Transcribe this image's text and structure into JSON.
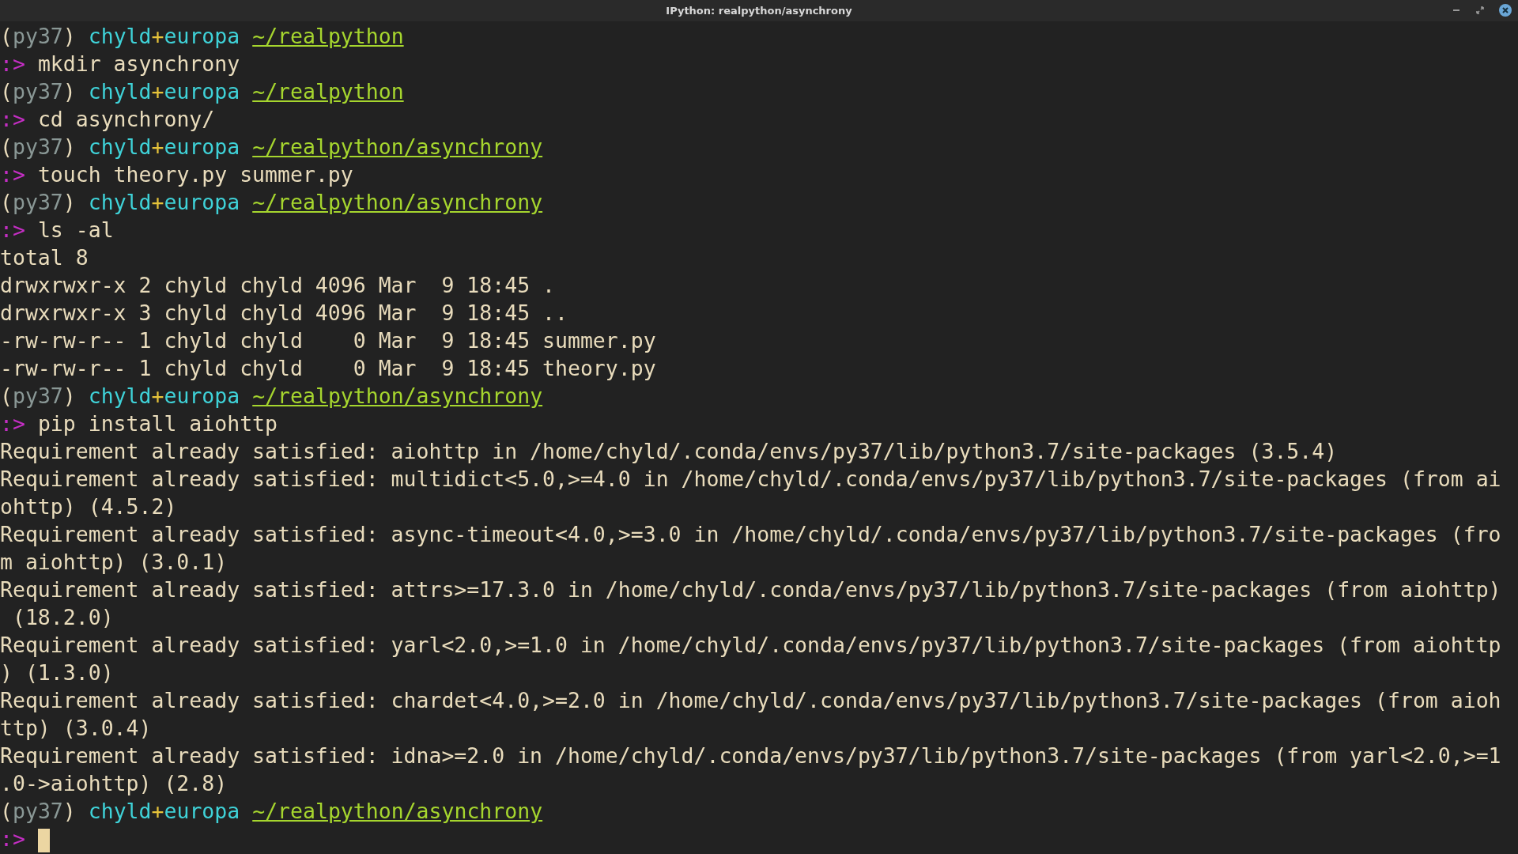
{
  "window": {
    "title": "IPython: realpython/asynchrony"
  },
  "lines": [
    {
      "kind": "prompt",
      "env": "(py37)",
      "user": "chyld",
      "sep": "+",
      "host": "europa",
      "path": "~/realpython"
    },
    {
      "kind": "command",
      "marker": ":>",
      "text": "mkdir asynchrony"
    },
    {
      "kind": "prompt",
      "env": "(py37)",
      "user": "chyld",
      "sep": "+",
      "host": "europa",
      "path": "~/realpython"
    },
    {
      "kind": "command",
      "marker": ":>",
      "text": "cd asynchrony/"
    },
    {
      "kind": "prompt",
      "env": "(py37)",
      "user": "chyld",
      "sep": "+",
      "host": "europa",
      "path": "~/realpython/asynchrony"
    },
    {
      "kind": "command",
      "marker": ":>",
      "text": "touch theory.py summer.py"
    },
    {
      "kind": "prompt",
      "env": "(py37)",
      "user": "chyld",
      "sep": "+",
      "host": "europa",
      "path": "~/realpython/asynchrony"
    },
    {
      "kind": "command",
      "marker": ":>",
      "text": "ls -al"
    },
    {
      "kind": "output",
      "text": "total 8"
    },
    {
      "kind": "output",
      "text": "drwxrwxr-x 2 chyld chyld 4096 Mar  9 18:45 ."
    },
    {
      "kind": "output",
      "text": "drwxrwxr-x 3 chyld chyld 4096 Mar  9 18:45 .."
    },
    {
      "kind": "output",
      "text": "-rw-rw-r-- 1 chyld chyld    0 Mar  9 18:45 summer.py"
    },
    {
      "kind": "output",
      "text": "-rw-rw-r-- 1 chyld chyld    0 Mar  9 18:45 theory.py"
    },
    {
      "kind": "prompt",
      "env": "(py37)",
      "user": "chyld",
      "sep": "+",
      "host": "europa",
      "path": "~/realpython/asynchrony"
    },
    {
      "kind": "command",
      "marker": ":>",
      "text": "pip install aiohttp"
    },
    {
      "kind": "output",
      "text": "Requirement already satisfied: aiohttp in /home/chyld/.conda/envs/py37/lib/python3.7/site-packages (3.5.4)"
    },
    {
      "kind": "output",
      "text": "Requirement already satisfied: multidict<5.0,>=4.0 in /home/chyld/.conda/envs/py37/lib/python3.7/site-packages (from ai"
    },
    {
      "kind": "output",
      "text": "ohttp) (4.5.2)"
    },
    {
      "kind": "output",
      "text": "Requirement already satisfied: async-timeout<4.0,>=3.0 in /home/chyld/.conda/envs/py37/lib/python3.7/site-packages (fro"
    },
    {
      "kind": "output",
      "text": "m aiohttp) (3.0.1)"
    },
    {
      "kind": "output",
      "text": "Requirement already satisfied: attrs>=17.3.0 in /home/chyld/.conda/envs/py37/lib/python3.7/site-packages (from aiohttp)"
    },
    {
      "kind": "output",
      "text": " (18.2.0)"
    },
    {
      "kind": "output",
      "text": "Requirement already satisfied: yarl<2.0,>=1.0 in /home/chyld/.conda/envs/py37/lib/python3.7/site-packages (from aiohttp"
    },
    {
      "kind": "output",
      "text": ") (1.3.0)"
    },
    {
      "kind": "output",
      "text": "Requirement already satisfied: chardet<4.0,>=2.0 in /home/chyld/.conda/envs/py37/lib/python3.7/site-packages (from aioh"
    },
    {
      "kind": "output",
      "text": "ttp) (3.0.4)"
    },
    {
      "kind": "output",
      "text": "Requirement already satisfied: idna>=2.0 in /home/chyld/.conda/envs/py37/lib/python3.7/site-packages (from yarl<2.0,>=1"
    },
    {
      "kind": "output",
      "text": ".0->aiohttp) (2.8)"
    },
    {
      "kind": "prompt",
      "env": "(py37)",
      "user": "chyld",
      "sep": "+",
      "host": "europa",
      "path": "~/realpython/asynchrony"
    },
    {
      "kind": "command",
      "marker": ":>",
      "cursor": true
    }
  ]
}
